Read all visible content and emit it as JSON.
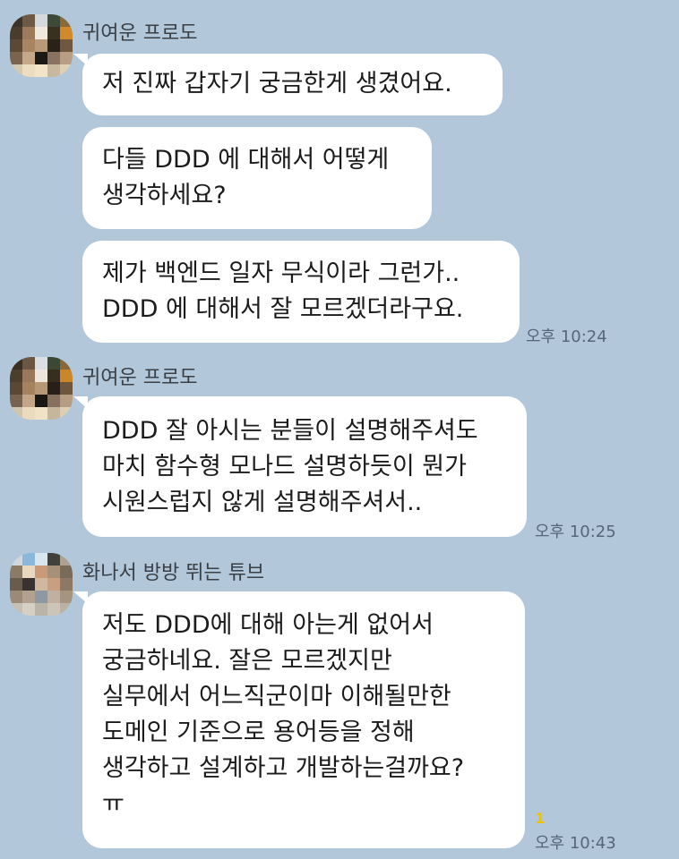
{
  "chat": {
    "groups": [
      {
        "sender": "귀여운 프로도",
        "avatar_icon": "pixelated-avatar",
        "messages": [
          {
            "lines": [
              "저 진짜 갑자기 궁금한게 생겼어요."
            ]
          },
          {
            "lines": [
              "다들 DDD 에 대해서 어떻게",
              "생각하세요?"
            ]
          },
          {
            "lines": [
              "제가 백엔드 일자 무식이라 그런가..",
              "DDD 에 대해서 잘 모르겠더라구요."
            ],
            "time": "오후 10:24"
          }
        ]
      },
      {
        "sender": "귀여운 프로도",
        "avatar_icon": "pixelated-avatar",
        "messages": [
          {
            "lines": [
              "DDD 잘 아시는 분들이 설명해주셔도",
              "마치 함수형 모나드 설명하듯이 뭔가",
              "시원스럽지 않게 설명해주셔서.."
            ],
            "time": "오후 10:25"
          }
        ]
      },
      {
        "sender": "화나서 방방 뛰는 튜브",
        "avatar_icon": "pixelated-avatar",
        "messages": [
          {
            "lines": [
              "저도 DDD에 대해 아는게 없어서",
              "궁금하네요. 잘은 모르겠지만",
              "실무에서 어느직군이마 이해될만한",
              "도메인 기준으로 용어등을 정해",
              "생각하고 설계하고 개발하는걸까요?",
              "ㅠ"
            ],
            "time": "오후 10:43",
            "unread": "1"
          }
        ]
      }
    ]
  },
  "colors": {
    "background": "#b2c7da",
    "bubble": "#ffffff",
    "unread": "#f2c200"
  }
}
